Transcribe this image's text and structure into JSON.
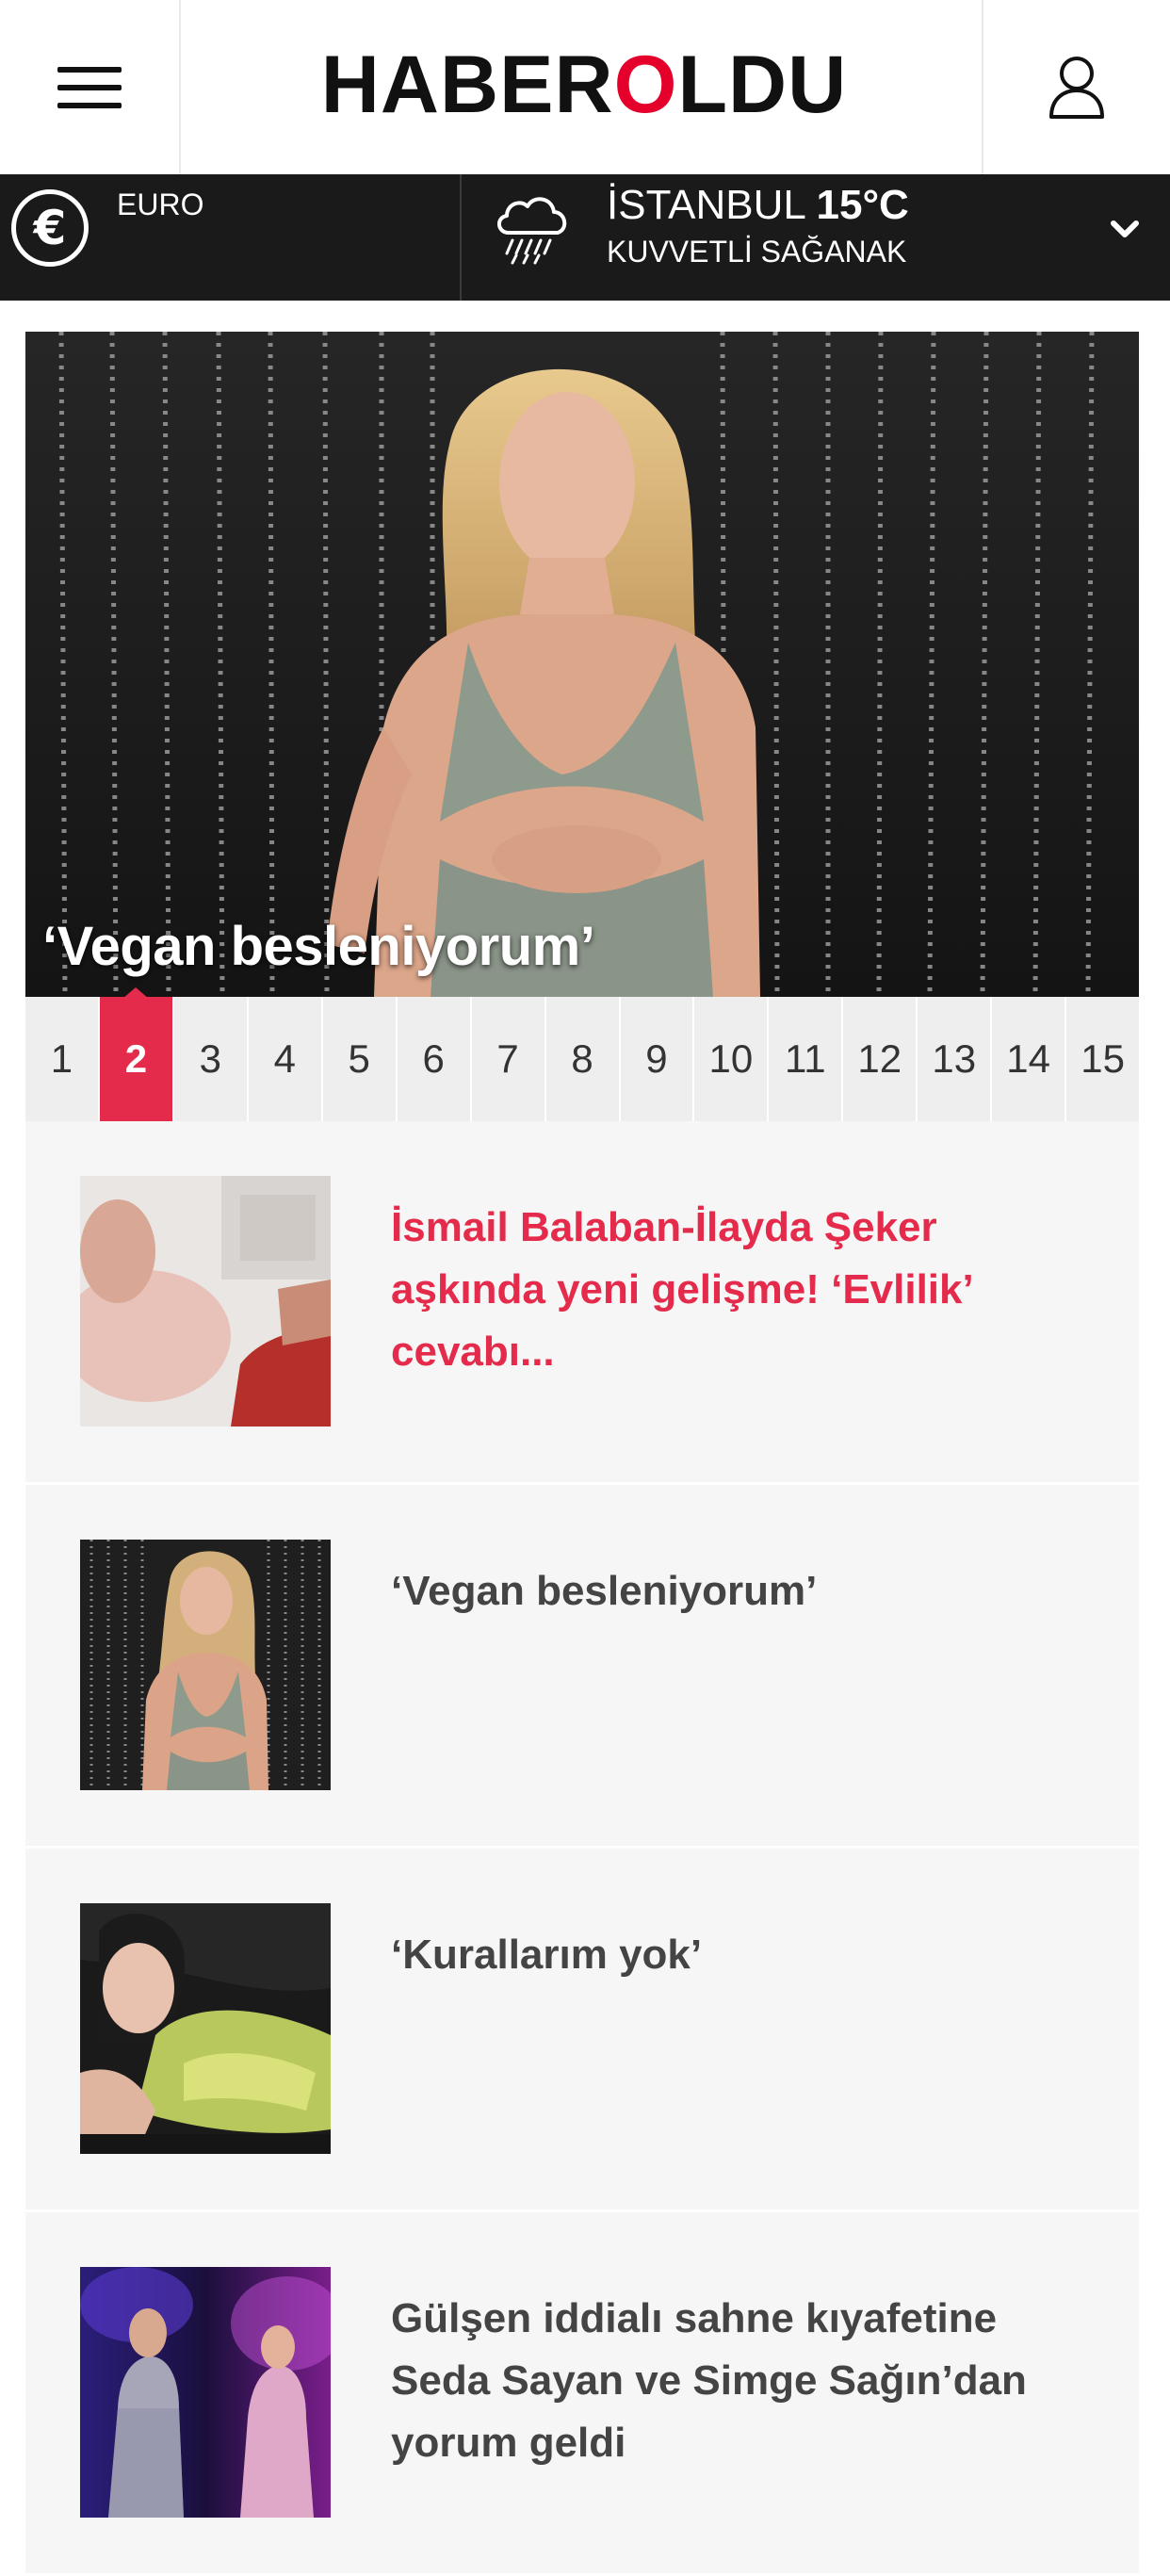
{
  "header": {
    "logo_part1": "HABER",
    "logo_o": "O",
    "logo_part2": "LDU"
  },
  "infobar": {
    "currency_label": "EURO",
    "currency_symbol": "€",
    "city": "İSTANBUL",
    "temperature": "15°C",
    "weather_desc": "KUVVETLİ SAĞANAK"
  },
  "hero": {
    "title": "‘Vegan besleniyorum’"
  },
  "pagination": {
    "pages": [
      "1",
      "2",
      "3",
      "4",
      "5",
      "6",
      "7",
      "8",
      "9",
      "10",
      "11",
      "12",
      "13",
      "14",
      "15"
    ],
    "active": "2"
  },
  "articles": [
    {
      "title": "İsmail Balaban-İlayda Şeker aşkında yeni gelişme! ‘Evlilik’ cevabı..."
    },
    {
      "title": "‘Vegan besleniyorum’"
    },
    {
      "title": "‘Kurallarım yok’"
    },
    {
      "title": "Gülşen iddialı sahne kıyafetine Seda Sayan ve Simge Sağın’dan yorum geldi"
    }
  ],
  "colors": {
    "accent": "#e52b4b",
    "logo_red": "#e4002b",
    "infobar_bg": "#1a1a1a"
  }
}
